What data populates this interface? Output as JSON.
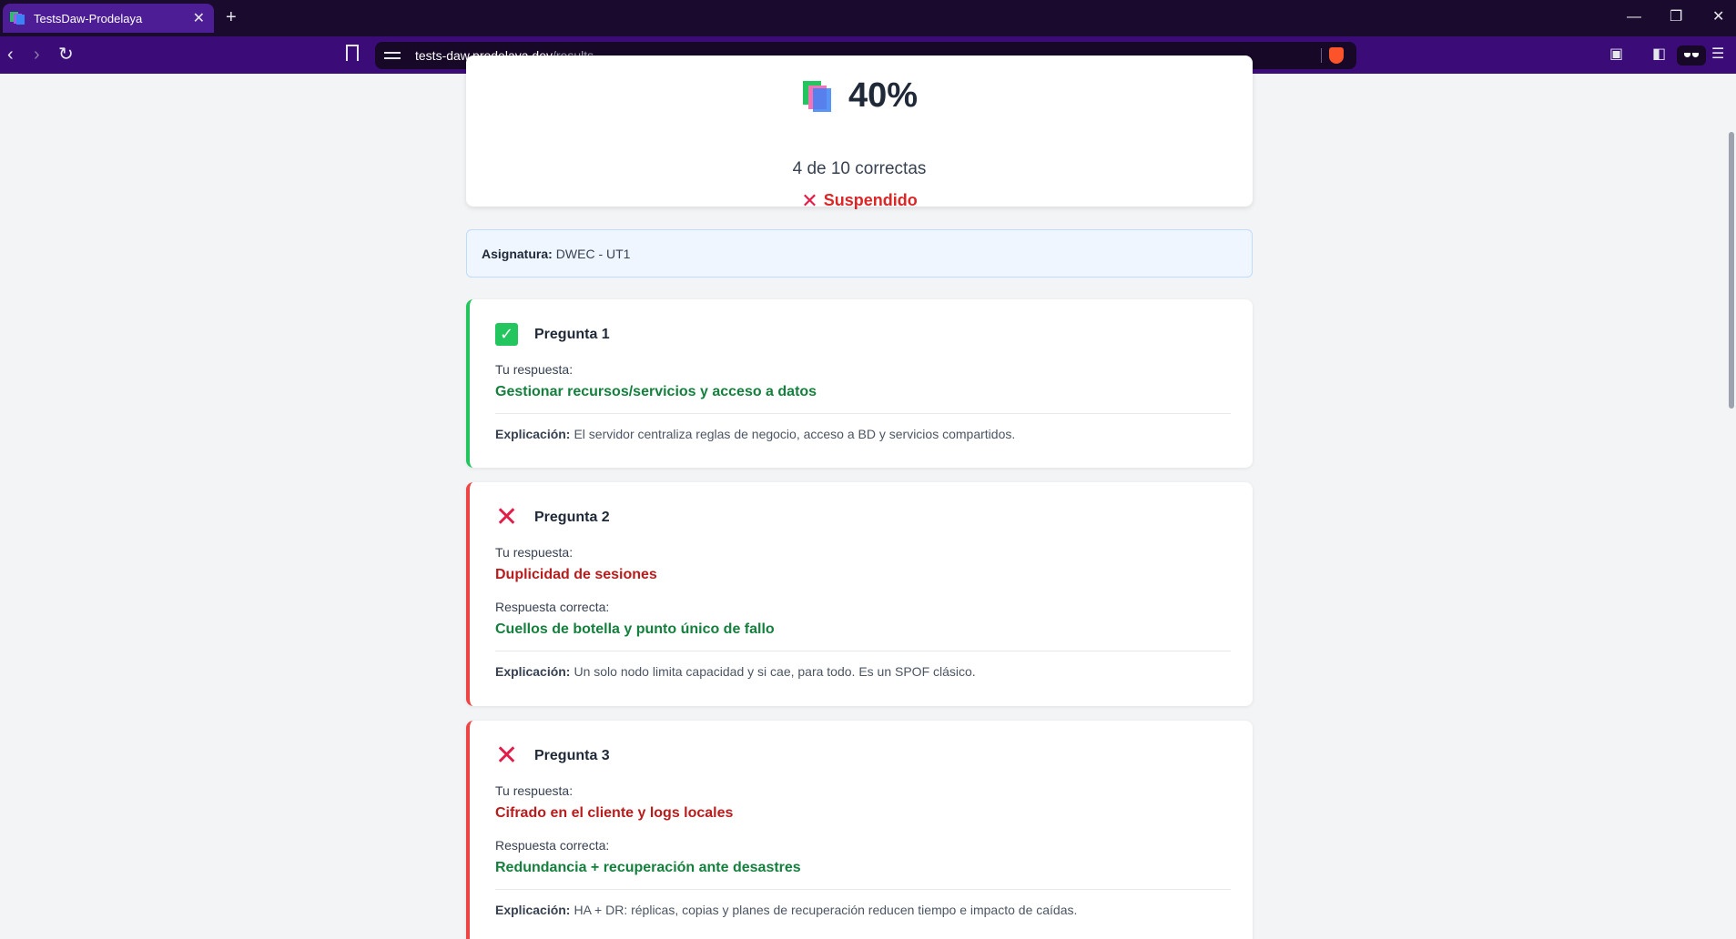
{
  "browser": {
    "tab_title": "TestsDaw-Prodelaya",
    "tab_close": "✕",
    "new_tab": "+",
    "url_host": "tests-daw.prodelaya.dev",
    "url_path": "/results",
    "minimize": "—",
    "restore": "❐",
    "close": "✕",
    "back": "‹",
    "forward": "›",
    "reload": "↻"
  },
  "score": {
    "percent": "40%",
    "summary": "4 de 10 correctas",
    "status": "Suspendido",
    "status_icon": "✕"
  },
  "subject": {
    "label": "Asignatura:",
    "value": "DWEC - UT1"
  },
  "questions": [
    {
      "title": "Pregunta 1",
      "result": "correct",
      "your_label": "Tu respuesta:",
      "your_answer": "Gestionar recursos/servicios y acceso a datos",
      "expl_label": "Explicación:",
      "explanation": "El servidor centraliza reglas de negocio, acceso a BD y servicios compartidos."
    },
    {
      "title": "Pregunta 2",
      "result": "incorrect",
      "your_label": "Tu respuesta:",
      "your_answer": "Duplicidad de sesiones",
      "correct_label": "Respuesta correcta:",
      "correct_answer": "Cuellos de botella y punto único de fallo",
      "expl_label": "Explicación:",
      "explanation": "Un solo nodo limita capacidad y si cae, para todo. Es un SPOF clásico."
    },
    {
      "title": "Pregunta 3",
      "result": "incorrect",
      "your_label": "Tu respuesta:",
      "your_answer": "Cifrado en el cliente y logs locales",
      "correct_label": "Respuesta correcta:",
      "correct_answer": "Redundancia + recuperación ante desastres",
      "expl_label": "Explicación:",
      "explanation": "HA + DR: réplicas, copias y planes de recuperación reducen tiempo e impacto de caídas."
    }
  ],
  "icons": {
    "check": "✓",
    "cross": "✕"
  },
  "colors": {
    "correct": "#22c55e",
    "incorrect": "#ef4444",
    "accent_toolbar": "#3b0b78"
  }
}
